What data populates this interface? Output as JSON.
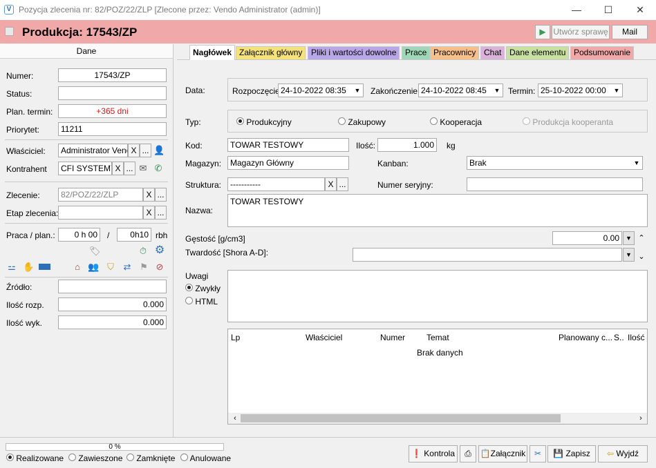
{
  "window": {
    "title": "Pozycja zlecenia nr: 82/POZ/22/ZLP [Zlecone przez: Vendo Administrator (admin)]",
    "app_icon": "V",
    "minimize": "—",
    "maximize": "☐",
    "close": "✕"
  },
  "header": {
    "title": "Produkcja: 17543/ZP",
    "play": "▶",
    "create_case": "Utwórz sprawę",
    "mail": "Mail"
  },
  "left": {
    "section_title": "Dane",
    "numer_label": "Numer:",
    "numer": "17543/ZP",
    "status_label": "Status:",
    "status": "",
    "plan_label": "Plan. termin:",
    "plan": "+365 dni",
    "priorytet_label": "Priorytet:",
    "priorytet": "11211",
    "wlasciciel_label": "Właściciel:",
    "wlasciciel": "Administrator Vendo",
    "kontrahent_label": "Kontrahent",
    "kontrahent": "CFI SYSTEMY",
    "zlecenie_label": "Zlecenie:",
    "zlecenie": "82/POZ/22/ZLP",
    "etap_label": "Etap zlecenia:",
    "etap": "",
    "praca_label": "Praca / plan.:",
    "praca": "0 h 00",
    "slash": "/",
    "plan_h": "0h10",
    "unit": "rbh",
    "zrodlo_label": "Źródło:",
    "zrodlo": "",
    "ilosc_rozp_label": "Ilość rozp.",
    "ilosc_rozp": "0.000",
    "ilosc_wyk_label": "Ilość wyk.",
    "ilosc_wyk": "0.000",
    "x": "X",
    "dots": "..."
  },
  "tabs": [
    "Nagłówek",
    "Załącznik główny",
    "Pliki i wartości dowolne",
    "Prace",
    "Pracownicy",
    "Chat",
    "Dane elementu",
    "Podsumowanie"
  ],
  "tab_colors": [
    "#ffffff",
    "#f5e27a",
    "#b9a6e6",
    "#9fd6b8",
    "#f7c08a",
    "#d9b1d9",
    "#c8e0a0",
    "#f0a8a8"
  ],
  "main": {
    "data_label": "Data:",
    "rozp_label": "Rozpoczęcie:",
    "rozp": "24-10-2022 08:35",
    "zak_label": "Zakończenie:",
    "zak": "24-10-2022 08:45",
    "termin_label": "Termin:",
    "termin": "25-10-2022 00:00",
    "typ_label": "Typ:",
    "typ_options": [
      "Produkcyjny",
      "Zakupowy",
      "Kooperacja",
      "Produkcja kooperanta"
    ],
    "kod_label": "Kod:",
    "kod": "TOWAR TESTOWY",
    "ilosc_label": "Ilość:",
    "ilosc": "1.000",
    "ilosc_unit": "kg",
    "magazyn_label": "Magazyn:",
    "magazyn": "Magazyn Główny",
    "kanban_label": "Kanban:",
    "kanban": "Brak",
    "struktura_label": "Struktura:",
    "struktura": "-----------",
    "numer_ser_label": "Numer seryjny:",
    "numer_ser": "",
    "nazwa_label": "Nazwa:",
    "nazwa": "TOWAR TESTOWY",
    "gestosc_label": "Gęstość [g/cm3]",
    "gestosc": "0.00",
    "twardosc_label": "Twardość [Shora A-D]:",
    "twardosc": "",
    "uwagi_label": "Uwagi",
    "uwagi_opts": [
      "Zwykły",
      "HTML"
    ]
  },
  "table": {
    "columns": [
      "Lp",
      "Właściciel",
      "Numer",
      "Temat",
      "Planowany c...",
      "S..",
      "Ilość"
    ],
    "empty": "Brak danych"
  },
  "footer": {
    "progress": "0 %",
    "progress_value": 0,
    "statuses": [
      "Realizowane",
      "Zawieszone",
      "Zamknięte",
      "Anulowane"
    ],
    "kontrola": "Kontrola",
    "zalacznik": "Załącznik",
    "zapisz": "Zapisz",
    "wyjdz": "Wyjdź"
  }
}
